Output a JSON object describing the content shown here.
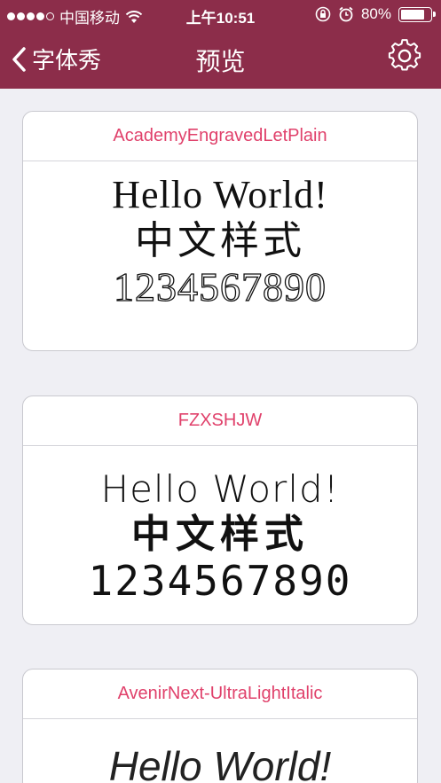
{
  "status_bar": {
    "carrier": "中国移动",
    "time": "上午10:51",
    "battery_percent": "80%",
    "signal_icon": "signal-dots-icon",
    "wifi_icon": "wifi-icon",
    "lock_icon": "rotation-lock-icon",
    "alarm_icon": "alarm-icon"
  },
  "nav": {
    "back_label": "字体秀",
    "title": "预览",
    "settings_icon": "gear-icon",
    "bar_color": "#8c2d4a"
  },
  "accent_color": "#e0416b",
  "cards": [
    {
      "font_name": "AcademyEngravedLetPlain",
      "line1": "Hello World!",
      "line2": "中文样式",
      "line3": "1234567890"
    },
    {
      "font_name": "FZXSHJW",
      "line1": "Hello World!",
      "line2": "中文样式",
      "line3": "1234567890"
    },
    {
      "font_name": "AvenirNext-UltraLightItalic",
      "line1": "Hello World!"
    }
  ]
}
